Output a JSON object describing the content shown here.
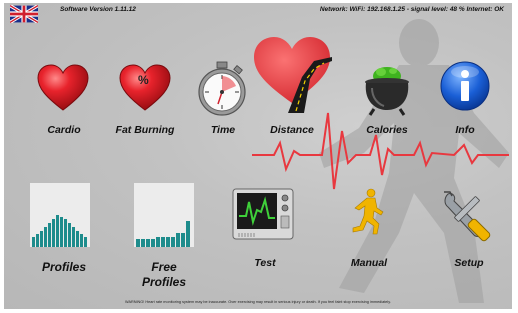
{
  "header": {
    "language_flag": "uk-flag-icon",
    "software_version": "Software Version 1.11.12",
    "network_status": "Network: WiFi: 192.168.1.25 - signal level: 48 % Internet: OK"
  },
  "menu": {
    "cardio": "Cardio",
    "fat_burning": "Fat Burning",
    "fat_burning_badge": "%",
    "time": "Time",
    "distance": "Distance",
    "calories": "Calories",
    "info": "Info",
    "profiles": "Profiles",
    "free_profiles_line1": "Free",
    "free_profiles_line2": "Profiles",
    "test": "Test",
    "manual": "Manual",
    "setup": "Setup"
  },
  "footer": {
    "warning": "WARNING! Heart rate monitoring system may be inaccurate. Over exercising may result in serious injury or death. If you feel faint stop exercising immediately."
  },
  "colors": {
    "background": "#bdbdbd",
    "heart_red": "#e8232c",
    "heartbeat_line": "#e8383f",
    "bar_teal": "#1e8c8c",
    "info_blue": "#1a5fd6",
    "runner_gold": "#f0b400"
  }
}
